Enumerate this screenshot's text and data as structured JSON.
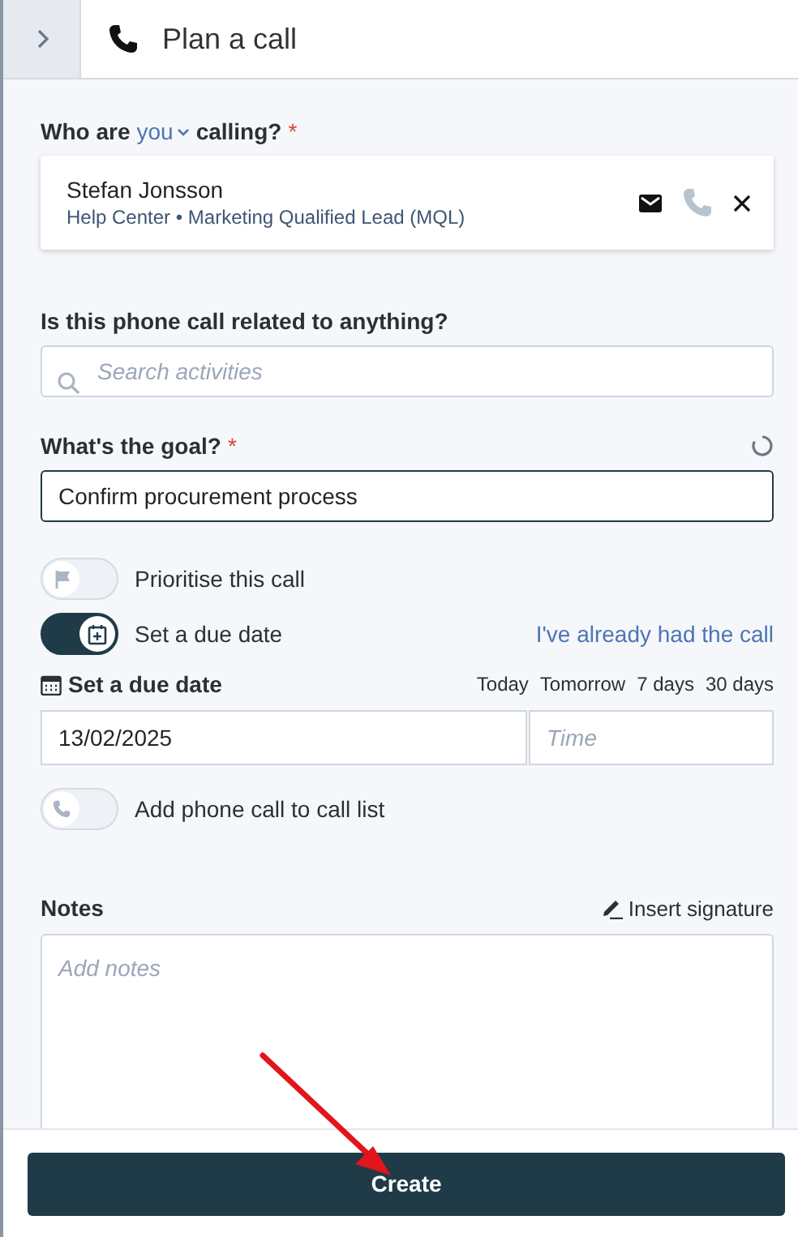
{
  "header": {
    "title": "Plan a call"
  },
  "contact": {
    "label_start": "Who are",
    "picker": "you",
    "label_end": "calling?",
    "required_mark": "*",
    "name": "Stefan Jonsson",
    "details": "Help Center • Marketing Qualified Lead (MQL)",
    "call_disabled": true
  },
  "related": {
    "label": "Is this phone call related to anything?",
    "placeholder": "Search activities"
  },
  "goal": {
    "label": "What's the goal?",
    "required_mark": "*",
    "value": "Confirm procurement process"
  },
  "toggles": [
    {
      "kind": "priority",
      "label": "Prioritise this call",
      "on": false
    },
    {
      "kind": "due",
      "label": "Set a due date",
      "on": true
    }
  ],
  "already_link": "I've already had the call",
  "due_date": {
    "label": "Set a due date",
    "quick_picks": [
      "Today",
      "Tomorrow",
      "7 days",
      "30 days"
    ],
    "date": "13/02/2025",
    "time_placeholder": "Time"
  },
  "call_list_toggle": {
    "kind": "call_list",
    "label": "Add phone call to call list",
    "on": false
  },
  "notes": {
    "label": "Notes",
    "signature_link": "Insert signature",
    "placeholder": "Add notes"
  },
  "footer": {
    "button": "Create"
  }
}
